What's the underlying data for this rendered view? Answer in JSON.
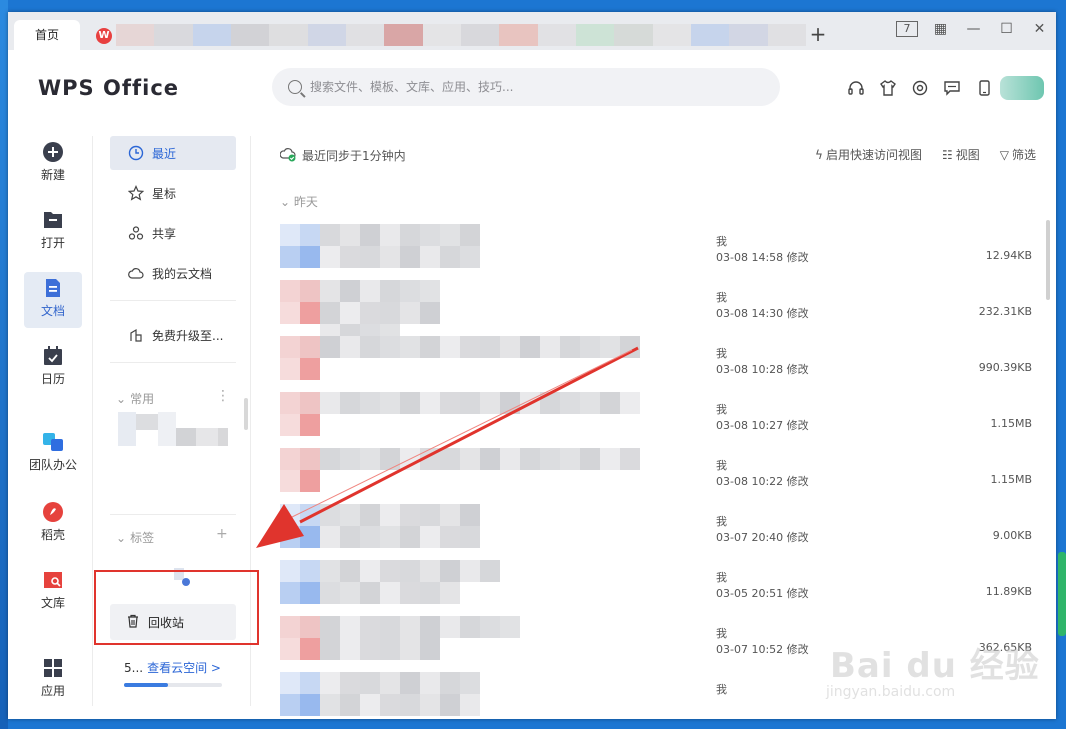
{
  "titlebar": {
    "home_tab": "首页",
    "add_tab": "+",
    "controls": [
      "7",
      "▦",
      "—",
      "☐",
      "✕"
    ]
  },
  "header": {
    "logo": "WPS Office",
    "search_placeholder": "搜索文件、模板、文库、应用、技巧..."
  },
  "nav": {
    "items": [
      {
        "label": "新建",
        "icon": "plus-circle-icon"
      },
      {
        "label": "打开",
        "icon": "folder-icon"
      },
      {
        "label": "文档",
        "icon": "document-icon"
      },
      {
        "label": "日历",
        "icon": "calendar-icon"
      },
      {
        "label": "团队办公",
        "icon": "team-icon"
      },
      {
        "label": "稻壳",
        "icon": "docer-icon"
      },
      {
        "label": "文库",
        "icon": "library-icon"
      },
      {
        "label": "应用",
        "icon": "apps-icon"
      }
    ]
  },
  "col2": {
    "items": [
      {
        "label": "最近",
        "icon": "clock-icon"
      },
      {
        "label": "星标",
        "icon": "star-icon"
      },
      {
        "label": "共享",
        "icon": "share-icon"
      },
      {
        "label": "我的云文档",
        "icon": "cloud-icon"
      }
    ],
    "upgrade": "免费升级至...",
    "common_header": "常用",
    "common_more": "⋮",
    "tags_header": "标签",
    "tags_add": "+",
    "recycle": "回收站",
    "cloud_prefix": "5...",
    "cloud_link": "查看云空间 >",
    "cloud_progress": 0.45
  },
  "main": {
    "sync_status": "最近同步于1分钟内",
    "quick_access": "启用快速访问视图",
    "view": "视图",
    "filter": "筛选",
    "group": "昨天",
    "files": [
      {
        "who": "我",
        "when": "03-08 14:58 修改",
        "size": "12.94KB",
        "thumb": "blue"
      },
      {
        "who": "我",
        "when": "03-08 14:30 修改",
        "size": "232.31KB",
        "thumb": "red"
      },
      {
        "who": "我",
        "when": "03-08 10:28 修改",
        "size": "990.39KB",
        "thumb": "red"
      },
      {
        "who": "我",
        "when": "03-08 10:27 修改",
        "size": "1.15MB",
        "thumb": "red"
      },
      {
        "who": "我",
        "when": "03-08 10:22 修改",
        "size": "1.15MB",
        "thumb": "red"
      },
      {
        "who": "我",
        "when": "03-07 20:40 修改",
        "size": "9.00KB",
        "thumb": "blue"
      },
      {
        "who": "我",
        "when": "03-05 20:51 修改",
        "size": "11.89KB",
        "thumb": "blue"
      },
      {
        "who": "我",
        "when": "03-07 10:52 修改",
        "size": "362.65KB",
        "thumb": "red"
      },
      {
        "who": "我",
        "when": "",
        "size": "",
        "thumb": "blue"
      }
    ]
  },
  "watermark": {
    "brand": "Bai du 经验",
    "url": "jingyan.baidu.com"
  },
  "colors": {
    "accent": "#2b66d6",
    "highlight_red": "#e0342d"
  }
}
